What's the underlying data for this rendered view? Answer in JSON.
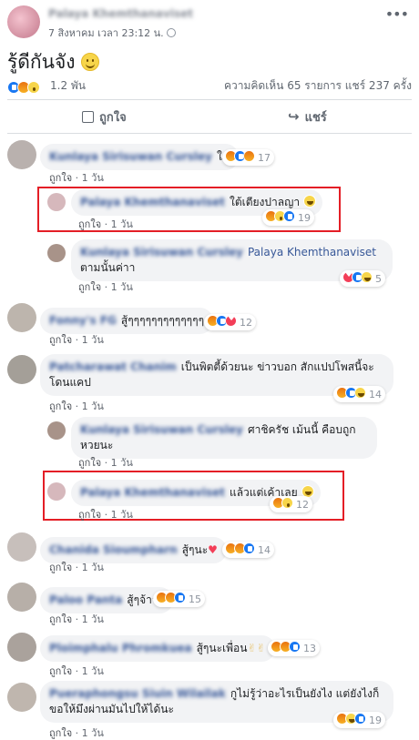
{
  "post": {
    "author": "Palaya Khemthanaviset",
    "time": "7 สิงหาคม เวลา 23:12 น.",
    "text": "รู้ดีกันจัง",
    "reaction_total": "1.2 พัน",
    "comments_count": "ความคิดเห็น 65 รายการ",
    "shares_count": "แชร์ 237 ครั้ง",
    "like_label": "ถูกใจ",
    "share_label": "แชร์"
  },
  "comments": [
    {
      "name": "Kunlaya Sirisuwan Cursley",
      "text": "ใช่",
      "like": "ถูกใจ",
      "time": "1 วัน",
      "count": "17"
    },
    {
      "name": "Palaya Khemthanaviset",
      "text": "ใต้เตียงปาลญา",
      "like": "ถูกใจ",
      "time": "1 วัน",
      "count": "19"
    },
    {
      "name": "Kunlaya Sirisuwan Cursley",
      "tag": "Palaya Khemthanaviset",
      "text": "ตามนั้นค่าา",
      "like": "ถูกใจ",
      "time": "1 วัน",
      "count": "5"
    },
    {
      "name": "Fonny's FG",
      "text": "สู้ๆๆๆๆๆๆๆๆๆๆๆๆๆ",
      "like": "ถูกใจ",
      "time": "1 วัน",
      "count": "12"
    },
    {
      "name": "Patcharawat Chanim",
      "text": "เป็นพิตตี้ด้วยนะ ข่าวบอก สักแปปโพสนี้จะโดนแคป",
      "like": "ถูกใจ",
      "time": "1 วัน",
      "count": "14"
    },
    {
      "name": "Kunlaya Sirisuwan Cursley",
      "text": "ศาชิครัช เม้นนี้ คือบถูกหวยนะ",
      "like": "ถูกใจ",
      "time": "1 วัน",
      "count": ""
    },
    {
      "name": "Palaya Khemthanaviset",
      "text": "แล้วแต่เค้าเลย",
      "like": "ถูกใจ",
      "time": "1 วัน",
      "count": "12"
    },
    {
      "name": "Chanida Sioumpharn",
      "text": "สู้ๆนะ",
      "like": "ถูกใจ",
      "time": "1 วัน",
      "count": "14"
    },
    {
      "name": "Paloo Panta",
      "text": "สู้ๆจ้าาา",
      "like": "ถูกใจ",
      "time": "1 วัน",
      "count": "15"
    },
    {
      "name": "Ploimphalu Phromkuea",
      "text": "สู้ๆนะเพื่อน",
      "like": "ถูกใจ",
      "time": "1 วัน",
      "count": "13"
    },
    {
      "name": "Pueraphongsu Siuin Wilailak",
      "text": "กูไม่รู้ว่าอะไรเป็นยังไง แต่ยังไงก็ขอให้มึงผ่านมันไปให้ได้นะ",
      "like": "ถูกใจ",
      "time": "1 วัน",
      "count": "19"
    }
  ],
  "colors": {
    "accent": "#385898",
    "highlight": "#e41e26",
    "like_blue": "#1877f2"
  }
}
